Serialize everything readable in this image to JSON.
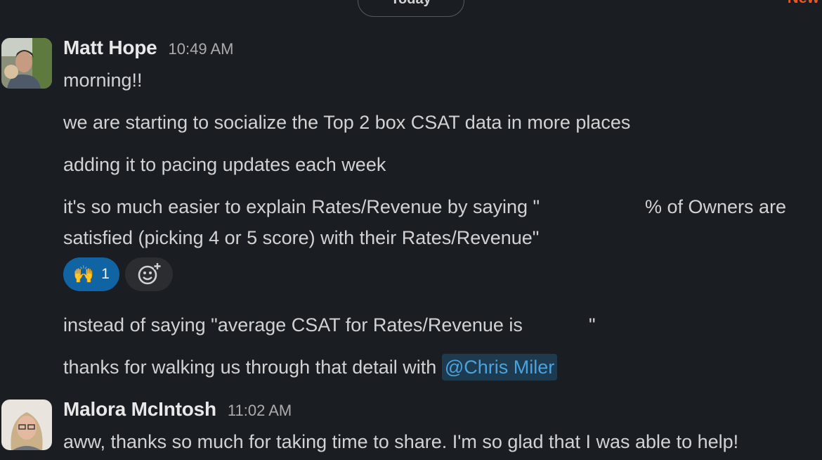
{
  "divider": {
    "day_label": "Today",
    "new_label": "New"
  },
  "messages": [
    {
      "sender": "Matt Hope",
      "time": "10:49 AM",
      "lines": [
        "morning!!",
        "we are starting to socialize the Top 2 box CSAT data in more places",
        "adding it to pacing updates each week",
        "it's so much easier to explain Rates/Revenue by saying \"",
        "% of Owners are",
        "satisfied (picking 4 or 5 score) with their Rates/Revenue\""
      ],
      "reactions": [
        {
          "emoji": "🙌",
          "count": "1"
        }
      ],
      "lines_after": [
        "instead of saying \"average CSAT for Rates/Revenue is",
        "\"",
        "thanks for walking us through that detail with"
      ],
      "mention": "@Chris Miler"
    },
    {
      "sender": "Malora McIntosh",
      "time": "11:02 AM",
      "lines": [
        "aww, thanks so much for taking time to share.  I'm so glad that I was able to help!"
      ]
    }
  ],
  "icons": {
    "add_reaction": "add-reaction-icon",
    "avatar": "avatar"
  }
}
